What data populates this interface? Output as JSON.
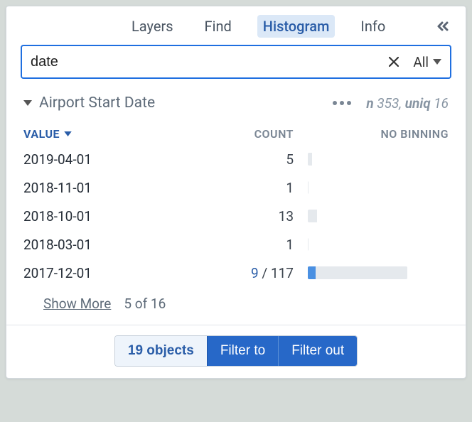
{
  "tabs": {
    "layers": "Layers",
    "find": "Find",
    "histogram": "Histogram",
    "info": "Info"
  },
  "search": {
    "value": "date",
    "scope_label": "All"
  },
  "field": {
    "title": "Airport Start Date",
    "n_label": "n",
    "n_value": "353",
    "uniq_label": "uniq",
    "uniq_value": "16"
  },
  "columns": {
    "value": "VALUE",
    "count": "COUNT",
    "binning": "NO BINNING"
  },
  "rows": [
    {
      "value": "2019-04-01",
      "count": "5",
      "sel": "",
      "total_pct": 4,
      "sel_pct": 0
    },
    {
      "value": "2018-11-01",
      "count": "1",
      "sel": "",
      "total_pct": 1,
      "sel_pct": 0
    },
    {
      "value": "2018-10-01",
      "count": "13",
      "sel": "",
      "total_pct": 9,
      "sel_pct": 0
    },
    {
      "value": "2018-03-01",
      "count": "1",
      "sel": "",
      "total_pct": 1,
      "sel_pct": 0
    },
    {
      "value": "2017-12-01",
      "count": "117",
      "sel": "9",
      "total_pct": 100,
      "sel_pct": 8
    }
  ],
  "showmore": {
    "link": "Show More",
    "position": "5 of 16"
  },
  "footer": {
    "count": "19 objects",
    "filter_to": "Filter to",
    "filter_out": "Filter out"
  }
}
